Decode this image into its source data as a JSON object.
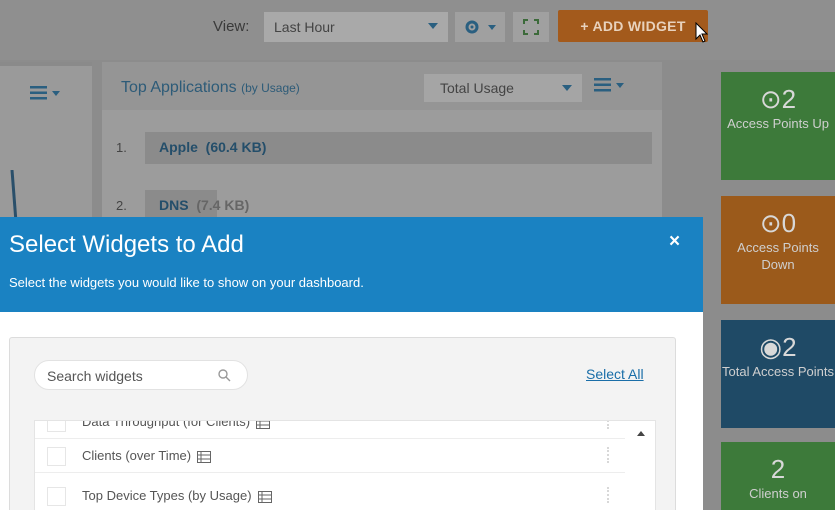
{
  "toolbar": {
    "view_label": "View:",
    "view_value": "Last Hour",
    "add_widget_label": "+ ADD WIDGET"
  },
  "apps_panel": {
    "title": "Top Applications",
    "title_sub": "(by Usage)",
    "usage_select": "Total Usage",
    "rows": [
      {
        "rank": "1.",
        "name": "Apple",
        "size": "(60.4 KB)",
        "share": 0.78
      },
      {
        "rank": "2.",
        "name": "DNS",
        "size": "(7.4 KB)",
        "share": 0.11
      }
    ]
  },
  "tiles": [
    {
      "num": "2",
      "label": "Access Points Up",
      "color": "#4a9c45"
    },
    {
      "num": "0",
      "label": "Access Points Down",
      "color": "#c97220"
    },
    {
      "num": "2",
      "label": "Total Access Points",
      "color": "#1e5f86"
    },
    {
      "num": "2",
      "label": "Clients on",
      "color": "#4a9c45"
    }
  ],
  "modal": {
    "title": "Select Widgets to Add",
    "subtitle": "Select the widgets you would like to show on your dashboard.",
    "close": "×",
    "search_placeholder": "Search widgets",
    "select_all": "Select All",
    "items": [
      {
        "label": "Data Throughput  (for Clients)"
      },
      {
        "label": "Clients  (over Time)"
      },
      {
        "label": "Top Device Types  (by Usage)"
      }
    ]
  },
  "colors": {
    "header_blue": "#1a82c2",
    "add_widget_orange": "#e0781e",
    "link_blue": "#1a6ea8"
  }
}
